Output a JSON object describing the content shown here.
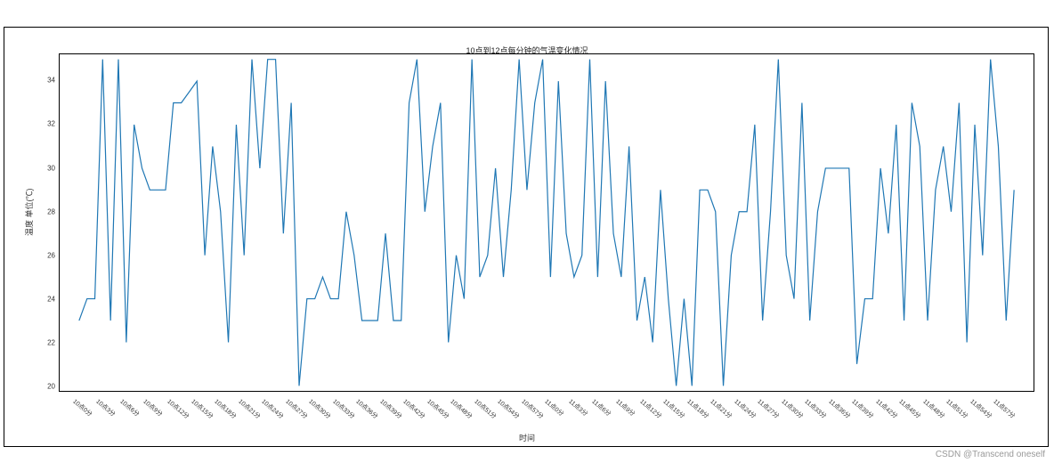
{
  "chart_data": {
    "type": "line",
    "title": "10点到12点每分钟的气温变化情况",
    "xlabel": "时间",
    "ylabel": "温度 单位(℃)",
    "ylim": [
      20,
      35
    ],
    "yticks": [
      20,
      22,
      24,
      26,
      28,
      30,
      32,
      34
    ],
    "xtick_labels": [
      "10点0分",
      "10点3分",
      "10点6分",
      "10点9分",
      "10点12分",
      "10点15分",
      "10点18分",
      "10点21分",
      "10点24分",
      "10点27分",
      "10点30分",
      "10点33分",
      "10点36分",
      "10点39分",
      "10点42分",
      "10点45分",
      "10点48分",
      "10点51分",
      "10点54分",
      "10点57分",
      "11点0分",
      "11点3分",
      "11点6分",
      "11点9分",
      "11点12分",
      "11点15分",
      "11点18分",
      "11点21分",
      "11点24分",
      "11点27分",
      "11点30分",
      "11点33分",
      "11点36分",
      "11点39分",
      "11点42分",
      "11点45分",
      "11点48分",
      "11点51分",
      "11点54分",
      "11点57分"
    ],
    "xtick_step": 3,
    "n": 120,
    "values": [
      23,
      24,
      24,
      35,
      23,
      35,
      22,
      32,
      30,
      29,
      29,
      29,
      33,
      33,
      33.5,
      34,
      26,
      31,
      28,
      22,
      32,
      26,
      35,
      30,
      35,
      35,
      27,
      33,
      20,
      24,
      24,
      25,
      24,
      24,
      28,
      26,
      23,
      23,
      23,
      27,
      23,
      23,
      33,
      35,
      28,
      31,
      33,
      22,
      26,
      24,
      35,
      25,
      26,
      30,
      25,
      29,
      35,
      29,
      33,
      35,
      25,
      34,
      27,
      25,
      26,
      35,
      25,
      34,
      27,
      25,
      31,
      23,
      25,
      22,
      29,
      24,
      20,
      24,
      20,
      29,
      29,
      28,
      20,
      26,
      28,
      28,
      32,
      23,
      28,
      35,
      26,
      24,
      33,
      23,
      28,
      30,
      30,
      30,
      30,
      21,
      24,
      24,
      30,
      27,
      32,
      23,
      33,
      31,
      23,
      29,
      31,
      28,
      33,
      22,
      32,
      26,
      35,
      31,
      23,
      29
    ],
    "line_color": "#1f77b4"
  },
  "watermark": "CSDN @Transcend oneself"
}
